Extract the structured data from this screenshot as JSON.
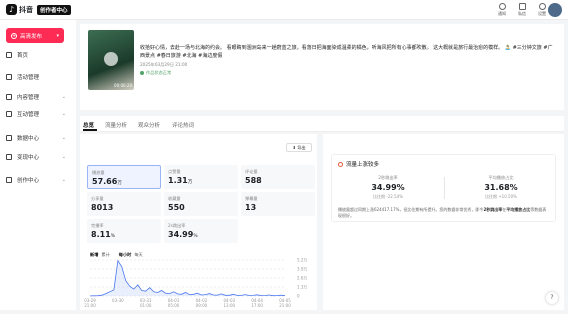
{
  "topbar": {
    "app_name": "抖音",
    "badge": "创作者中心",
    "icons": [
      {
        "label": "通知",
        "icon": "bell-icon"
      },
      {
        "label": "私信",
        "icon": "message-icon"
      },
      {
        "label": "设置",
        "icon": "gear-icon"
      }
    ]
  },
  "sidebar": {
    "publish_button": "高清发布",
    "items": [
      {
        "label": "首页",
        "icon": "home-icon"
      },
      {
        "label": "活动管理",
        "icon": "flag-icon"
      },
      {
        "label": "内容管理",
        "icon": "content-icon"
      },
      {
        "label": "互动管理",
        "icon": "chat-icon"
      },
      {
        "label": "数据中心",
        "icon": "chart-icon"
      },
      {
        "label": "变现中心",
        "icon": "coin-icon"
      },
      {
        "label": "创作中心",
        "icon": "star-icon"
      }
    ]
  },
  "video": {
    "title": "收拾好心情，去赴一场与北海的约会。 看眼睛到涠洲岛来一趟蔚蓝之旅，看落日把海面染成温柔的橘色，听海风把所有心事都吹散。 这大概就是旅行最治愈的模样。 🏝️ #三分钟文旅 #广西景点 #春日旅游 #北海 #海边度假",
    "date": "2025年03月29日 21:00",
    "duration": "00:00:20",
    "status": "作品状态正常"
  },
  "tabs": [
    "总览",
    "流量分析",
    "观众分析",
    "评论热词"
  ],
  "overview": {
    "export_label": "导出",
    "metrics": [
      {
        "label": "播放量",
        "value": "57.66",
        "unit": "万"
      },
      {
        "label": "点赞量",
        "value": "1.31",
        "unit": "万"
      },
      {
        "label": "评论量",
        "value": "588",
        "unit": ""
      },
      {
        "label": "分享量",
        "value": "8013",
        "unit": ""
      },
      {
        "label": "收藏量",
        "value": "550",
        "unit": ""
      },
      {
        "label": "弹幕量",
        "value": "13",
        "unit": ""
      },
      {
        "label": "完播率",
        "value": "8.11",
        "unit": "%"
      },
      {
        "label": "2s跳出率",
        "value": "34.99",
        "unit": "%"
      }
    ],
    "toggle": {
      "a": "新增",
      "b": "累计",
      "c": "每小时",
      "d": "每天"
    }
  },
  "traffic_alert": {
    "title": "流量上涨较多",
    "stat1": {
      "label": "2秒跳出率",
      "value": "34.99%",
      "compare": "比往期 -22.54%"
    },
    "stat2": {
      "label": "平均播放占比",
      "value": "31.68%",
      "compare": "比往期 +10.50%"
    },
    "desc_prefix": "播放量超过同期上涨624417.17%，但比往期有所提升。您的数据非常优秀，即今",
    "desc_bold": "2秒跳出率",
    "desc_mid": "在",
    "desc_bold2": "平均播放占比",
    "desc_suffix": "等数据表现很好。"
  },
  "chart_data": {
    "type": "area",
    "title": "",
    "x": [
      "03-29 21:00",
      "03-30 ",
      "03-31 01:00",
      "04-01 05:00",
      "04-02 09:00",
      "04-03 13:00",
      "04-04 17:00",
      "04-05 21:00"
    ],
    "ylabels": [
      "5.2万",
      "3.9万",
      "2.6万",
      "1.3万",
      "0"
    ],
    "ylim": [
      0,
      52000
    ],
    "series": [
      {
        "values": [
          200,
          300,
          500,
          1200,
          3500,
          6000,
          9000,
          51000,
          42000,
          22000,
          14000,
          10000,
          16000,
          8000,
          7000,
          12000,
          6000,
          5000,
          8000,
          4000,
          3500,
          6000,
          3000,
          2500,
          5000,
          2000,
          2500,
          4000,
          1500,
          2000,
          3500,
          1500,
          1200,
          3000,
          1000,
          1000,
          2500,
          800,
          900,
          2000,
          700,
          800,
          1800,
          600,
          700,
          1500,
          500,
          600,
          1200,
          500
        ]
      }
    ]
  }
}
